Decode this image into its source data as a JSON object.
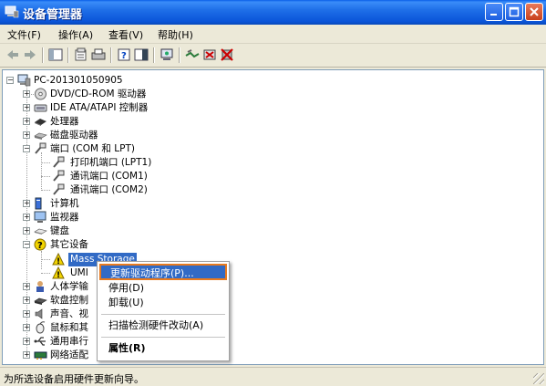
{
  "window": {
    "title": "设备管理器"
  },
  "menubar": [
    {
      "label": "文件(F)"
    },
    {
      "label": "操作(A)"
    },
    {
      "label": "查看(V)"
    },
    {
      "label": "帮助(H)"
    }
  ],
  "toolbar": {
    "icons": [
      "back-arrow-icon",
      "forward-arrow-icon",
      "show-hide-tree-icon",
      "properties-icon",
      "print-icon",
      "help-icon",
      "console-icon",
      "scan-hardware-icon",
      "update-driver-icon",
      "disable-device-icon",
      "uninstall-device-icon"
    ]
  },
  "tree": {
    "root": "PC-201301050905",
    "items": [
      {
        "label": "DVD/CD-ROM 驱动器",
        "icon": "cdrom-icon"
      },
      {
        "label": "IDE ATA/ATAPI 控制器",
        "icon": "ide-controller-icon"
      },
      {
        "label": "处理器",
        "icon": "processor-icon"
      },
      {
        "label": "磁盘驱动器",
        "icon": "disk-drive-icon"
      },
      {
        "label": "端口 (COM 和 LPT)",
        "icon": "port-icon",
        "children": [
          {
            "label": "打印机端口 (LPT1)",
            "icon": "port-icon"
          },
          {
            "label": "通讯端口 (COM1)",
            "icon": "port-icon"
          },
          {
            "label": "通讯端口 (COM2)",
            "icon": "port-icon"
          }
        ]
      },
      {
        "label": "计算机",
        "icon": "computer-icon"
      },
      {
        "label": "监视器",
        "icon": "monitor-icon"
      },
      {
        "label": "键盘",
        "icon": "keyboard-icon"
      },
      {
        "label": "其它设备",
        "icon": "unknown-device-icon",
        "children": [
          {
            "label": "Mass Storage",
            "icon": "unknown-device-icon"
          },
          {
            "label": "UMI",
            "icon": "unknown-device-icon"
          }
        ]
      },
      {
        "label": "人体学输",
        "icon": "hid-icon"
      },
      {
        "label": "软盘控制",
        "icon": "floppy-controller-icon"
      },
      {
        "label": "声音、视",
        "icon": "sound-icon"
      },
      {
        "label": "鼠标和其",
        "icon": "mouse-icon"
      },
      {
        "label": "通用串行",
        "icon": "usb-icon"
      },
      {
        "label": "网络适配",
        "icon": "network-adapter-icon"
      }
    ]
  },
  "context_menu": [
    {
      "label": "更新驱动程序(P)...",
      "highlighted": true
    },
    {
      "label": "停用(D)"
    },
    {
      "label": "卸载(U)"
    },
    {
      "separator": true
    },
    {
      "label": "扫描检测硬件改动(A)"
    },
    {
      "separator": true
    },
    {
      "label": "属性(R)",
      "bold": true
    }
  ],
  "status": {
    "text": "为所选设备启用硬件更新向导。"
  },
  "colors": {
    "titlebar": "#0a54d8",
    "selection": "#316ac5",
    "highlight_border": "#e87a1e",
    "warning_icon": "#f2d400"
  }
}
